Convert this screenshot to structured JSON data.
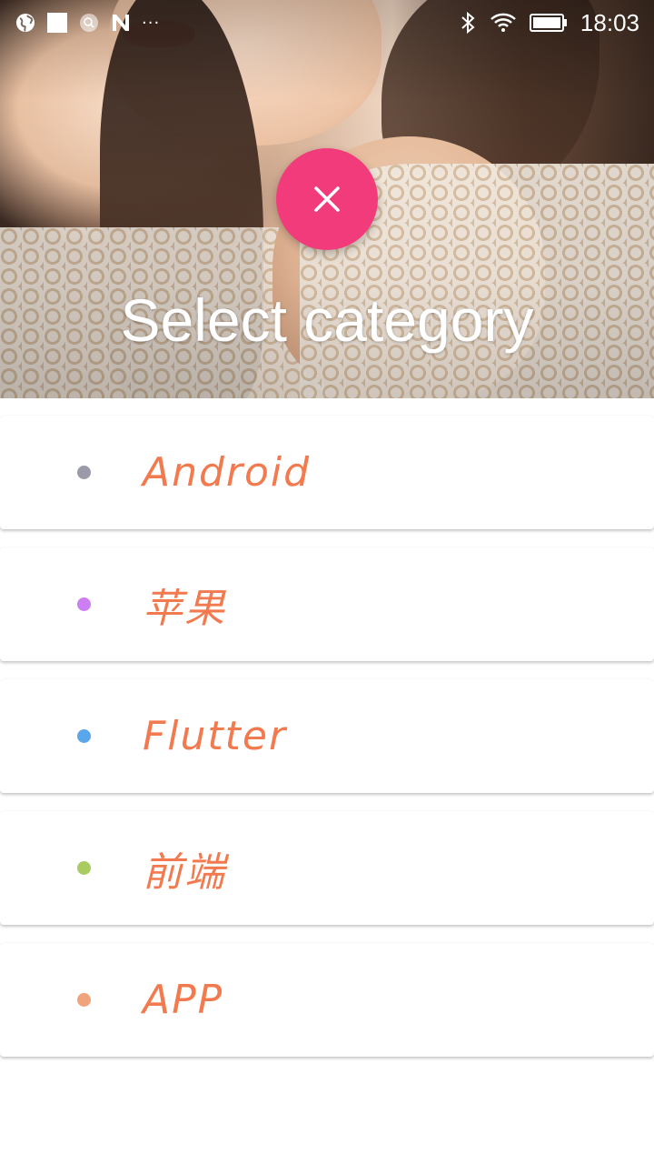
{
  "status_bar": {
    "time": "18:03",
    "left_icons": [
      "globe-icon",
      "square-icon",
      "search-circle-icon",
      "n-logo-icon",
      "more-dots-icon"
    ],
    "right_icons": [
      "bluetooth-icon",
      "wifi-icon",
      "battery-icon"
    ],
    "more_dots": "···"
  },
  "header": {
    "title": "Select category",
    "close_icon": "close-icon"
  },
  "categories": [
    {
      "label": "Android",
      "dot_color": "#9b9aa8"
    },
    {
      "label": "苹果",
      "dot_color": "#cc7ef2"
    },
    {
      "label": "Flutter",
      "dot_color": "#5aa6ea"
    },
    {
      "label": "前端",
      "dot_color": "#a8cc62"
    },
    {
      "label": "APP",
      "dot_color": "#f0a47c"
    }
  ],
  "colors": {
    "accent": "#f23b7a",
    "label": "#f27a4e"
  }
}
